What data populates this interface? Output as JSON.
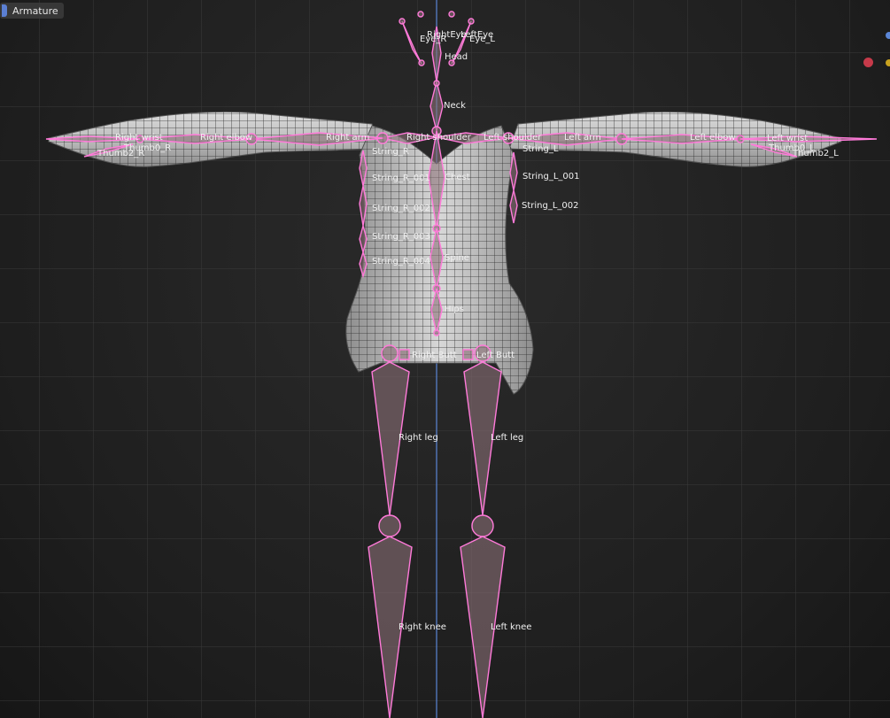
{
  "header": {
    "object_name": "Armature",
    "object_icon": "armature-object-icon"
  },
  "colors": {
    "bone_outline": "#ff7ad9",
    "bone_fill": "#8a7076",
    "mesh_wire": "#3a3a3a",
    "grid": "#3c3c3c",
    "axis_y": "#5b86d6",
    "gizmo_red": "#c63a4a",
    "gizmo_yellow": "#c9a21f"
  },
  "bones": [
    {
      "id": "head",
      "label": "Head"
    },
    {
      "id": "neck",
      "label": "Neck"
    },
    {
      "id": "eye_r",
      "label": "Eye_R"
    },
    {
      "id": "eye_l",
      "label": "Eye_L"
    },
    {
      "id": "right_eye",
      "label": "RightEye"
    },
    {
      "id": "left_eye",
      "label": "LeftEye"
    },
    {
      "id": "chest",
      "label": "Chest"
    },
    {
      "id": "spine",
      "label": "Spine"
    },
    {
      "id": "hips",
      "label": "Hips"
    },
    {
      "id": "right_shoulder",
      "label": "Right shoulder"
    },
    {
      "id": "left_shoulder",
      "label": "Left shoulder"
    },
    {
      "id": "right_arm",
      "label": "Right arm"
    },
    {
      "id": "left_arm",
      "label": "Left arm"
    },
    {
      "id": "right_elbow",
      "label": "Right elbow"
    },
    {
      "id": "left_elbow",
      "label": "Left elbow"
    },
    {
      "id": "right_wrist",
      "label": "Right wrist"
    },
    {
      "id": "left_wrist",
      "label": "Left wrist"
    },
    {
      "id": "thumb2_r",
      "label": "Thumb2_R"
    },
    {
      "id": "thumb2_l",
      "label": "Thumb2_L"
    },
    {
      "id": "thumb0_r",
      "label": "Thumb0_R"
    },
    {
      "id": "thumb0_l",
      "label": "Thumb0_L"
    },
    {
      "id": "string_r",
      "label": "String_R"
    },
    {
      "id": "string_r_001",
      "label": "String_R_001"
    },
    {
      "id": "string_r_002",
      "label": "String_R_002"
    },
    {
      "id": "string_r_003",
      "label": "String_R_003"
    },
    {
      "id": "string_r_004",
      "label": "String_R_004"
    },
    {
      "id": "string_l",
      "label": "String_L"
    },
    {
      "id": "string_l_001",
      "label": "String_L_001"
    },
    {
      "id": "string_l_002",
      "label": "String_L_002"
    },
    {
      "id": "right_butt",
      "label": "Right Butt"
    },
    {
      "id": "left_butt",
      "label": "Left Butt"
    },
    {
      "id": "right_leg",
      "label": "Right leg"
    },
    {
      "id": "left_leg",
      "label": "Left leg"
    },
    {
      "id": "right_knee",
      "label": "Right knee"
    },
    {
      "id": "left_knee",
      "label": "Left knee"
    }
  ]
}
